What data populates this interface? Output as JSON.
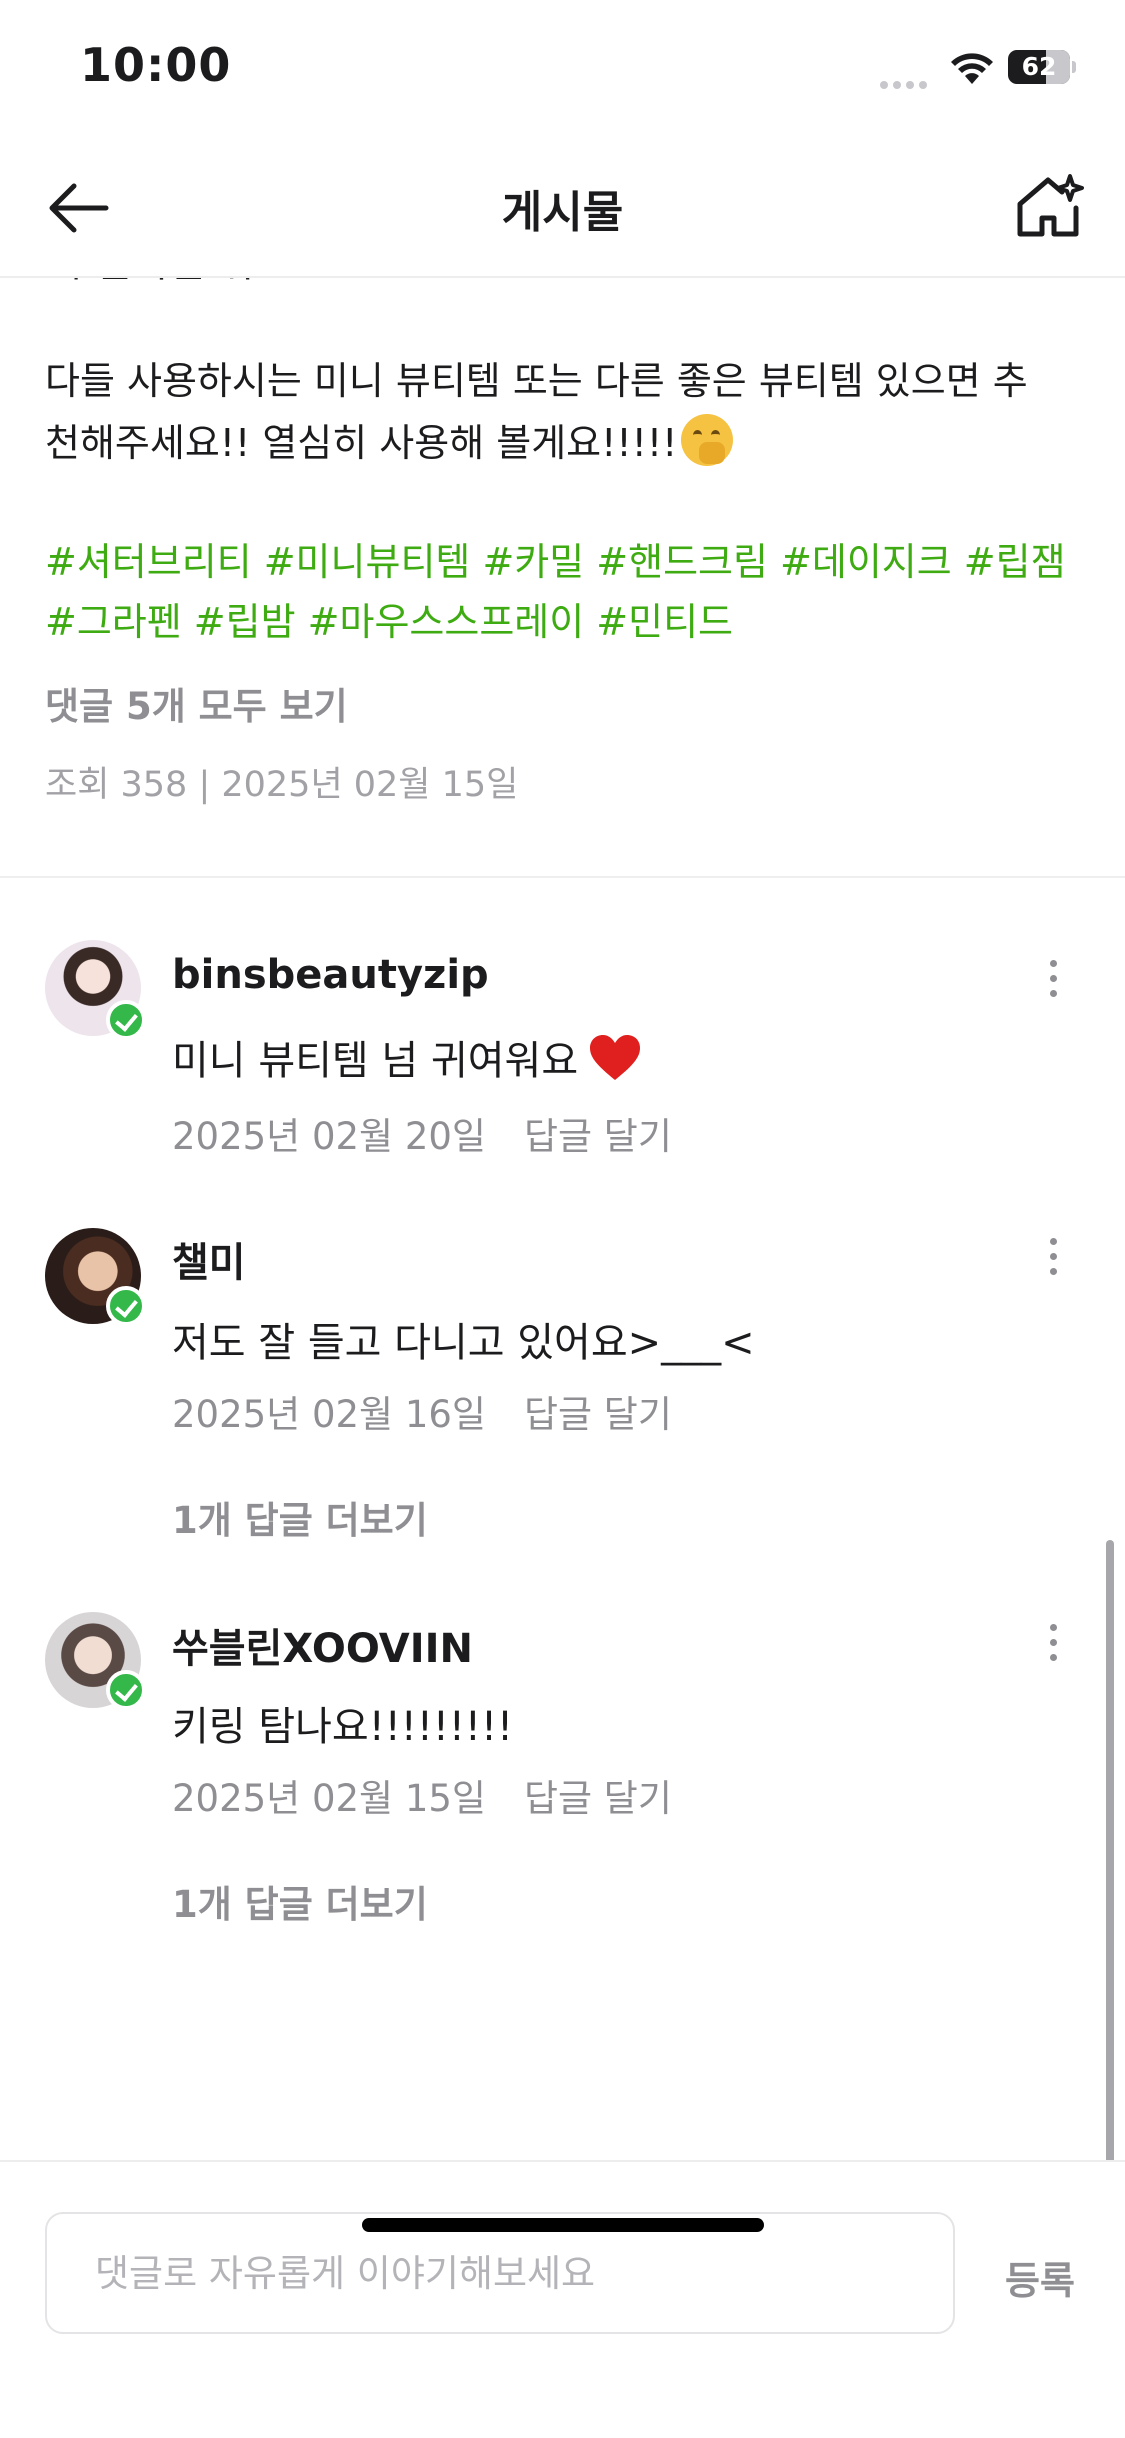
{
  "status_bar": {
    "time": "10:00",
    "battery": "62",
    "battery_level": 0.62
  },
  "nav": {
    "title": "게시물"
  },
  "post": {
    "partial_line": "제 일저일 위.",
    "body_lines": [
      "다들 사용하시는 미니 뷰티템 또는 다른 좋은 뷰티템 있으면 추",
      "천해주세요!! 열심히 사용해 볼게요!!!!!"
    ],
    "hashtag_lines": [
      "#셔터브리티 #미니뷰티템 #카밀 #핸드크림 #데이지크 #립잼",
      "#그라펜 #립밤 #마우스스프레이 #민티드"
    ],
    "view_all_comments": "댓글 5개 모두 보기",
    "meta": "조회 358 | 2025년 02월 15일"
  },
  "comments": [
    {
      "username": "binsbeautyzip",
      "text": "미니 뷰티템 넘 귀여워요",
      "date": "2025년 02월 20일",
      "reply_label": "답글 달기"
    },
    {
      "username": "챌미",
      "text": "저도 잘 들고 다니고 있어요>___<",
      "date": "2025년 02월 16일",
      "reply_label": "답글 달기",
      "more_replies": "1개 답글 더보기"
    },
    {
      "username": "쑤블린XOOVIIN",
      "text": "키링 탐나요!!!!!!!!!",
      "date": "2025년 02월 15일",
      "reply_label": "답글 달기",
      "more_replies": "1개 답글 더보기"
    }
  ],
  "input": {
    "placeholder": "댓글로 자유롭게 이야기해보세요",
    "submit_label": "등록"
  },
  "colors": {
    "hashtag": "#3dab11",
    "muted": "#8e8e93",
    "verified": "#33b849"
  }
}
